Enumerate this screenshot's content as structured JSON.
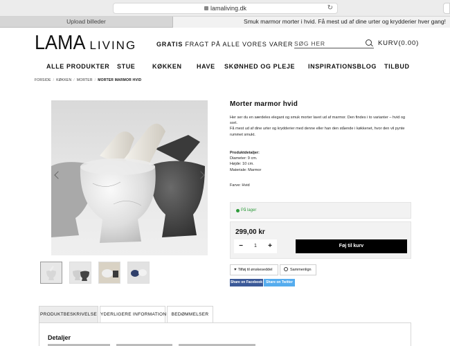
{
  "browser": {
    "url": "lamaliving.dk",
    "tabs": [
      {
        "label": "Upload billeder",
        "active": false
      },
      {
        "label": "Smuk marmor morter i hvid. Få mest ud af dine urter og krydderier hver gang!",
        "active": true
      }
    ]
  },
  "header": {
    "logo_main": "LAMA",
    "logo_sub": "LIVING",
    "shipping_bold": "GRATIS",
    "shipping_rest": " FRAGT PÅ ALLE VORES VARER",
    "search_placeholder": "SØG HER",
    "cart_label": "KURV",
    "cart_total": "(0.00)"
  },
  "nav": {
    "items": [
      "ALLE PRODUKTER",
      "STUE",
      "KØKKEN",
      "HAVE",
      "SKØNHED OG PLEJE",
      "INSPIRATIONSBLOG",
      "TILBUD"
    ]
  },
  "breadcrumb": [
    "FORSIDE",
    "KØKKEN",
    "MORTER",
    "MORTER MARMOR HVID"
  ],
  "product": {
    "title": "Morter marmor hvid",
    "description_1": "Her ser du en særdeles elegant og smuk morter lavet ud af marmor. Den findes i to varianter – hvid og sort.",
    "description_2": "Få mest ud af dine urter og krydderier med denne eller han den stående i køkkenet, hvor den vil pynte rummet smukt.",
    "details_heading": "Produktdetaljer:",
    "details": [
      "Diameter: 9 cm.",
      "Højde: 10 cm.",
      "Materiale: Marmor"
    ],
    "color_line": "Farve: Hvid",
    "stock": "På lager",
    "price": "299,00 kr",
    "quantity": "1",
    "qty_minus": "−",
    "qty_plus": "+",
    "add_to_cart": "Føj til kurv",
    "wishlist": "Tilføj til ønskeseddel",
    "compare": "Sammenlign",
    "share_facebook": "Share on Facebook",
    "share_twitter": "Share on Twitter"
  },
  "tabs": {
    "items": [
      "PRODUKTBESKRIVELSE",
      "YDERLIGERE INFORMATION",
      "BEDØMMELSER"
    ],
    "panel_title": "Detaljer"
  },
  "colors": {
    "stock_green": "#2e9b3b",
    "facebook": "#3b5998",
    "twitter": "#55acee",
    "button_black": "#000000"
  }
}
